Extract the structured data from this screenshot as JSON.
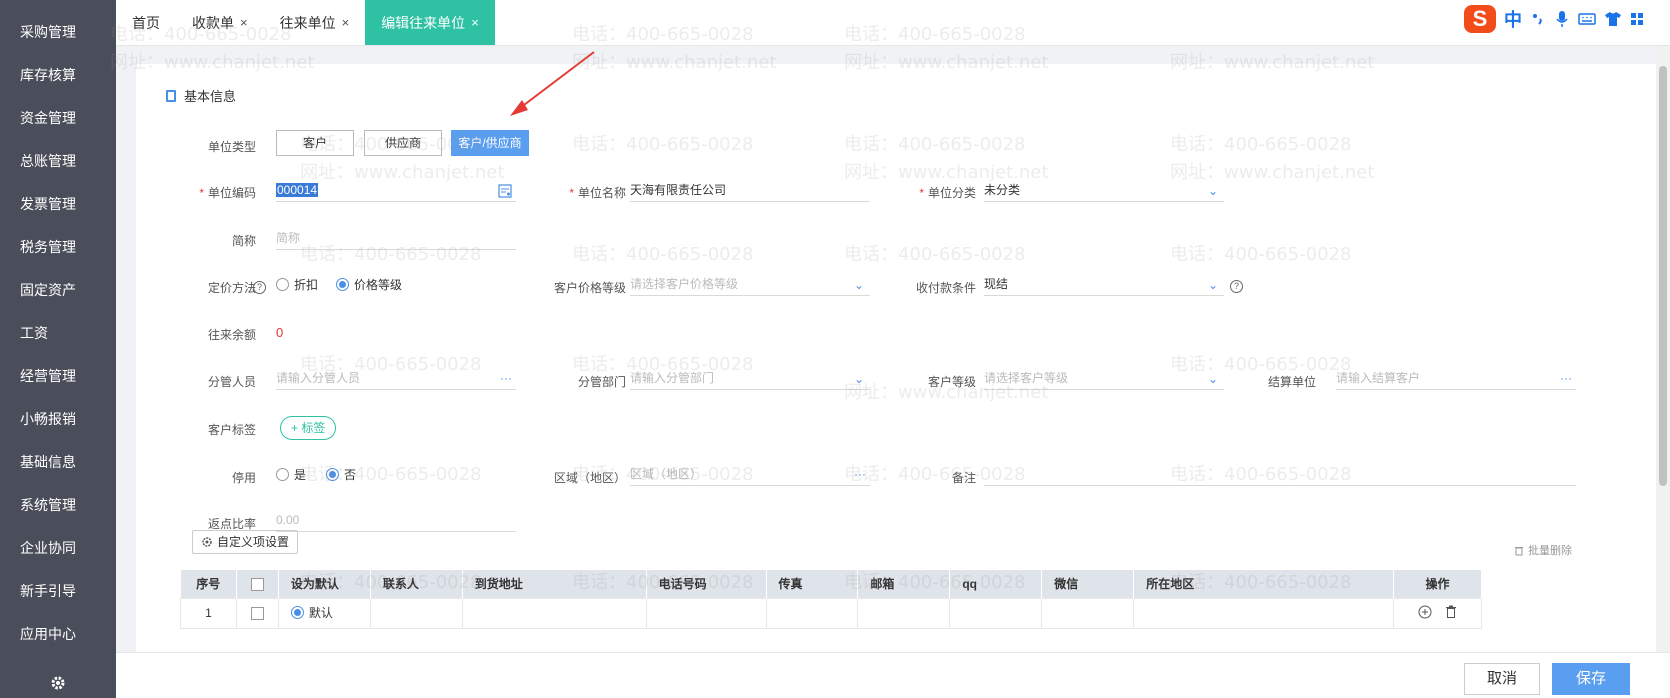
{
  "sidebar": {
    "items": [
      {
        "label": "采购管理"
      },
      {
        "label": "库存核算"
      },
      {
        "label": "资金管理"
      },
      {
        "label": "总账管理"
      },
      {
        "label": "发票管理"
      },
      {
        "label": "税务管理"
      },
      {
        "label": "固定资产"
      },
      {
        "label": "工资"
      },
      {
        "label": "经营管理"
      },
      {
        "label": "小畅报销"
      },
      {
        "label": "基础信息"
      },
      {
        "label": "系统管理"
      },
      {
        "label": "企业协同"
      },
      {
        "label": "新手引导"
      },
      {
        "label": "应用中心"
      }
    ]
  },
  "tabs": [
    {
      "label": "首页",
      "close": ""
    },
    {
      "label": "收款单",
      "close": "×"
    },
    {
      "label": "往来单位",
      "close": "×"
    },
    {
      "label": "编辑往来单位",
      "close": "×"
    }
  ],
  "ime": {
    "logo": "S",
    "mode": "中"
  },
  "section": {
    "title": "基本信息"
  },
  "form": {
    "unit_type_label": "单位类型",
    "unit_type_options": [
      "客户",
      "供应商",
      "客户/供应商"
    ],
    "unit_code_label": "单位编码",
    "unit_code_value": "000014",
    "unit_name_label": "单位名称",
    "unit_name_value": "天海有限责任公司",
    "unit_category_label": "单位分类",
    "unit_category_value": "未分类",
    "short_name_label": "简称",
    "short_name_placeholder": "简称",
    "pricing_label": "定价方法",
    "pricing_options": [
      "折扣",
      "价格等级"
    ],
    "price_level_label": "客户价格等级",
    "price_level_placeholder": "请选择客户价格等级",
    "payment_terms_label": "收付款条件",
    "payment_terms_value": "现结",
    "balance_label": "往来余额",
    "balance_value": "0",
    "manager_label": "分管人员",
    "manager_placeholder": "请输入分管人员",
    "dept_label": "分管部门",
    "dept_placeholder": "请输入分管部门",
    "cust_level_label": "客户等级",
    "cust_level_placeholder": "请选择客户等级",
    "settle_unit_label": "结算单位",
    "settle_unit_placeholder": "请输入结算客户",
    "cust_tag_label": "客户标签",
    "tag_button": "+ 标签",
    "disabled_label": "停用",
    "disabled_options": [
      "是",
      "否"
    ],
    "region_label": "区域（地区）",
    "region_placeholder": "区域（地区）",
    "remark_label": "备注",
    "rebate_label": "返点比率",
    "rebate_placeholder": "0.00",
    "ellipsis": "···",
    "qmark": "?"
  },
  "custom_button": "自定义项设置",
  "batch_delete": "批量删除",
  "table": {
    "headers": [
      "序号",
      "",
      "设为默认",
      "联系人",
      "到货地址",
      "电话号码",
      "传真",
      "邮箱",
      "qq",
      "微信",
      "所在地区",
      "操作"
    ],
    "rows": [
      {
        "index": "1",
        "default_label": "默认"
      }
    ]
  },
  "footer": {
    "cancel": "取消",
    "save": "保存"
  },
  "watermark": {
    "phone": "电话：400-665-0028",
    "site": "网址：www.chanjet.net"
  },
  "colors": {
    "accent": "#2ec1a4",
    "primary": "#5a9ef0",
    "sidebar": "#4a4e5a"
  }
}
